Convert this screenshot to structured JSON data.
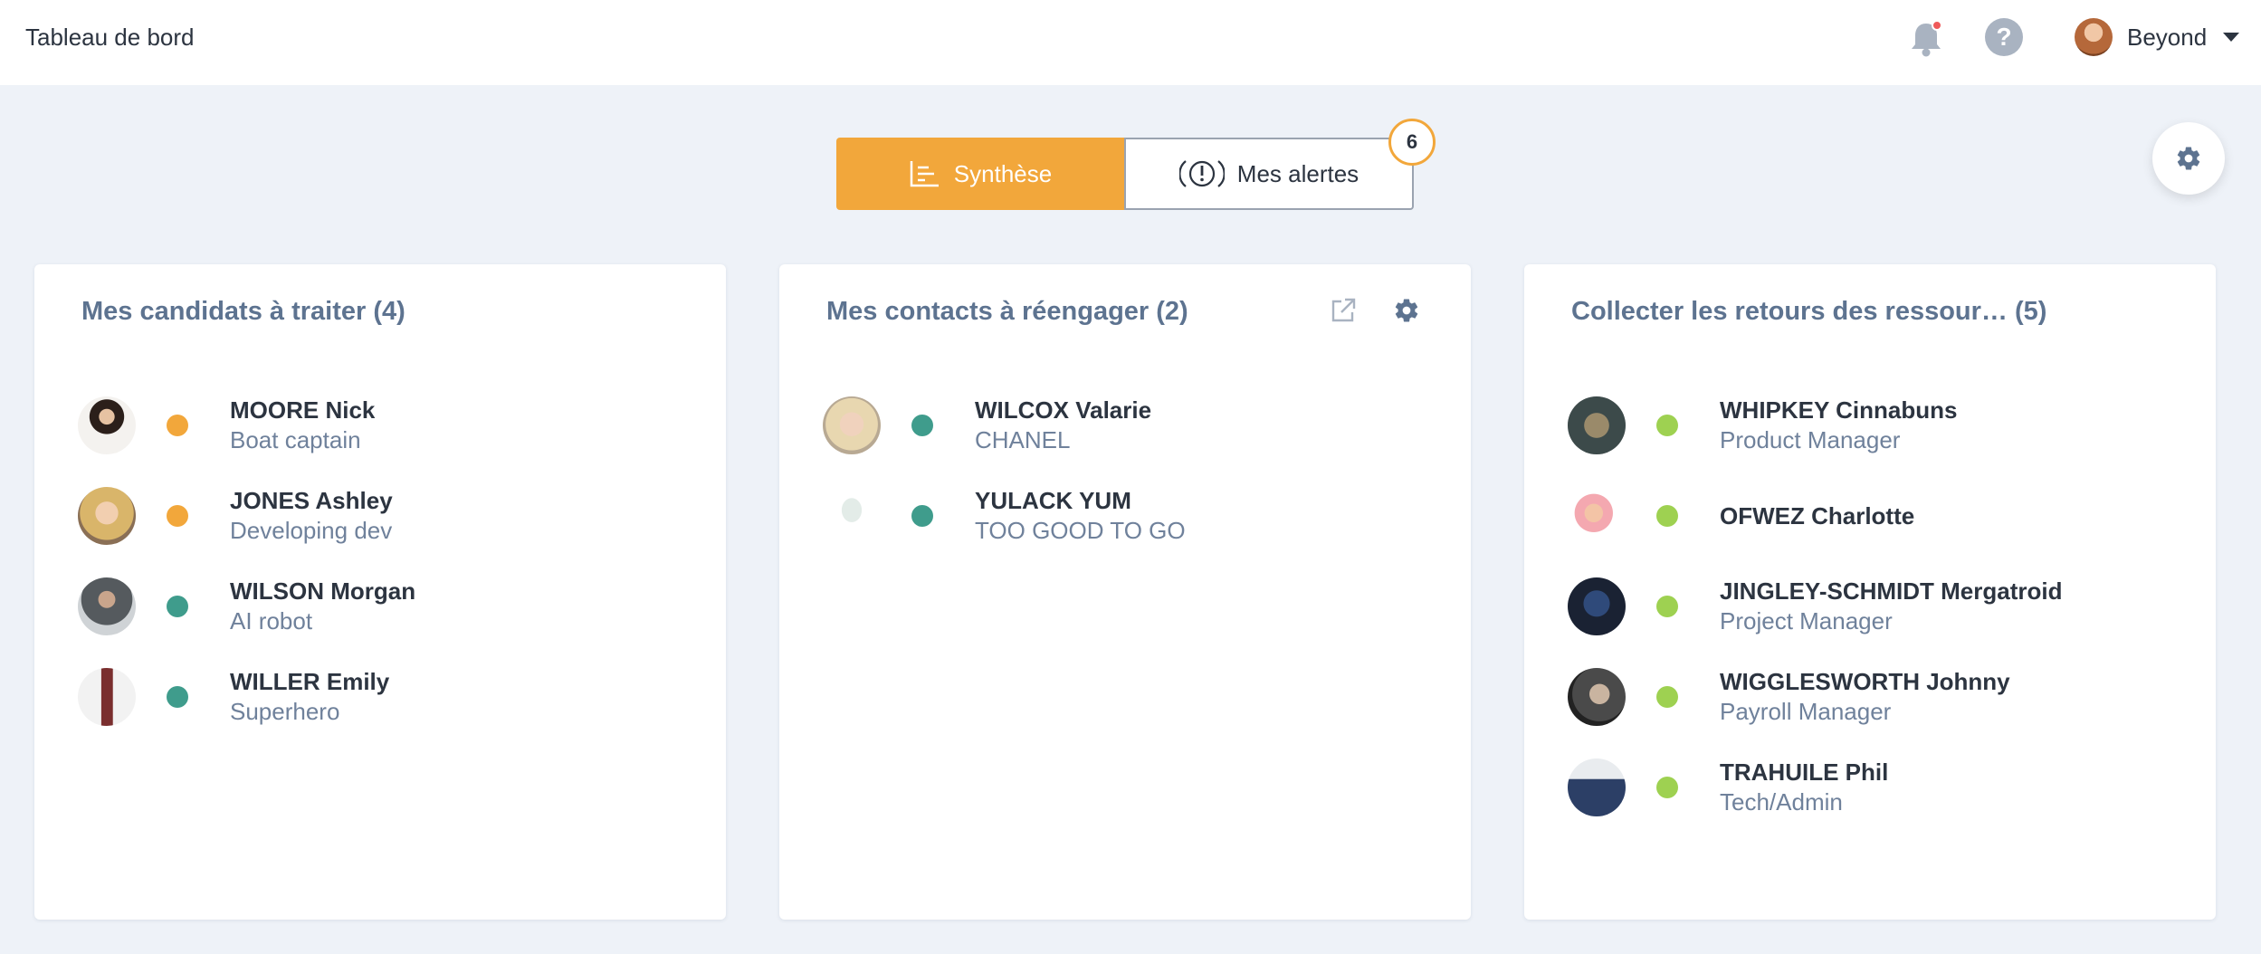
{
  "topbar": {
    "title": "Tableau de bord",
    "user_name": "Beyond"
  },
  "tabs": {
    "synthese_label": "Synthèse",
    "alertes_label": "Mes alertes",
    "alertes_count": "6"
  },
  "cards": [
    {
      "title": "Mes candidats à traiter (4)",
      "items": [
        {
          "name": "MOORE Nick",
          "sub": "Boat captain",
          "status": "orange"
        },
        {
          "name": "JONES Ashley",
          "sub": "Developing dev",
          "status": "orange"
        },
        {
          "name": "WILSON Morgan",
          "sub": "AI robot",
          "status": "teal"
        },
        {
          "name": "WILLER Emily",
          "sub": "Superhero",
          "status": "teal"
        }
      ]
    },
    {
      "title": "Mes contacts à réengager (2)",
      "items": [
        {
          "name": "WILCOX Valarie",
          "sub": "CHANEL",
          "status": "teal"
        },
        {
          "name": "YULACK YUM",
          "sub": "TOO GOOD TO GO",
          "status": "teal"
        }
      ]
    },
    {
      "title": "Collecter les retours des ressour… (5)",
      "items": [
        {
          "name": "WHIPKEY Cinnabuns",
          "sub": "Product Manager",
          "status": "lime"
        },
        {
          "name": "OFWEZ Charlotte",
          "sub": "",
          "status": "lime"
        },
        {
          "name": "JINGLEY-SCHMIDT Mergatroid",
          "sub": "Project Manager",
          "status": "lime"
        },
        {
          "name": "WIGGLESWORTH Johnny",
          "sub": "Payroll Manager",
          "status": "lime"
        },
        {
          "name": "TRAHUILE Phil",
          "sub": "Tech/Admin",
          "status": "lime"
        }
      ]
    }
  ],
  "colors": {
    "accent": "#f2a73b",
    "status_orange": "#f2a73b",
    "status_teal": "#3f9c8c",
    "status_lime": "#9ed151",
    "card_title": "#5d7390"
  },
  "icons": [
    "bell-icon",
    "help-icon",
    "chevron-down-icon",
    "chart-icon",
    "alert-icon",
    "gear-icon",
    "external-link-icon"
  ]
}
